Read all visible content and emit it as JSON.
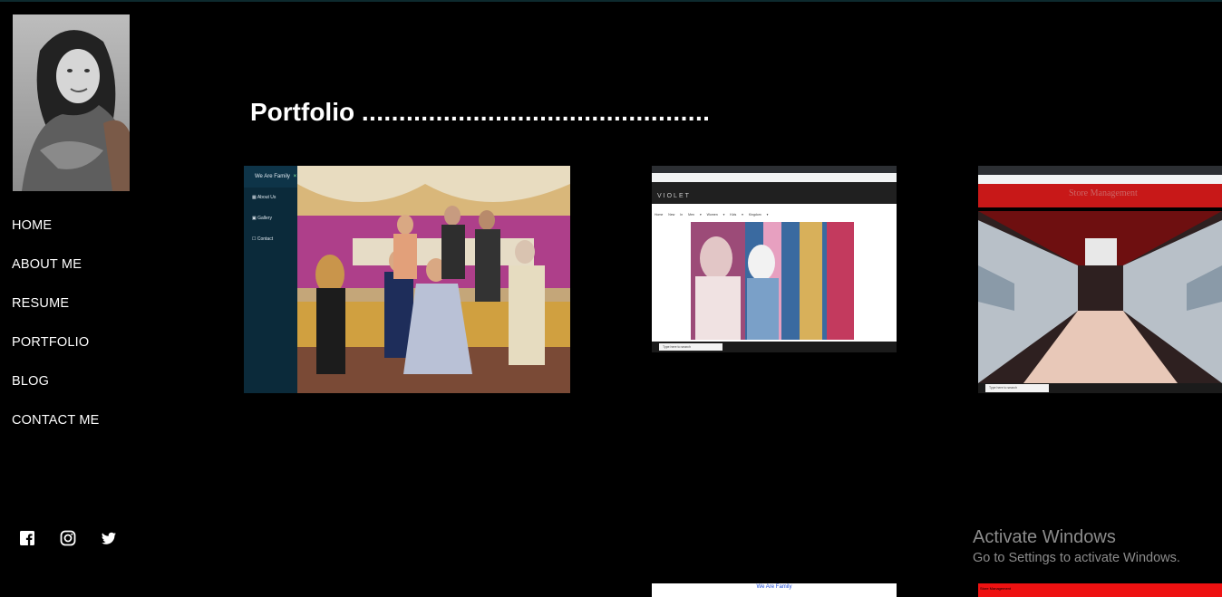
{
  "sidebar": {
    "nav": [
      "HOME",
      "ABOUT ME",
      "RESUME",
      "PORTFOLIO",
      "BLOG",
      "CONTACT ME"
    ],
    "social_icons": [
      "facebook-icon",
      "instagram-icon",
      "twitter-icon"
    ]
  },
  "main": {
    "heading": "Portfolio",
    "heading_dots": "...............................................",
    "cards": {
      "family": {
        "app_title": "We Are Family",
        "close_glyph": "×",
        "menu": [
          "About Us",
          "Gallery",
          "Contact"
        ]
      },
      "violet": {
        "logo": "VIOLET",
        "menu": "Home New In Men ▾ Women ▾ Kids ▾ Kingdom ▾",
        "search": "Type here to search"
      },
      "store": {
        "title": "Store Management",
        "search": "Type here to search"
      },
      "family_second": {
        "label": "We Are Family"
      },
      "store_second": {
        "label": "Store Management"
      }
    }
  },
  "watermark": {
    "title": "Activate Windows",
    "subtitle": "Go to Settings to activate Windows."
  }
}
